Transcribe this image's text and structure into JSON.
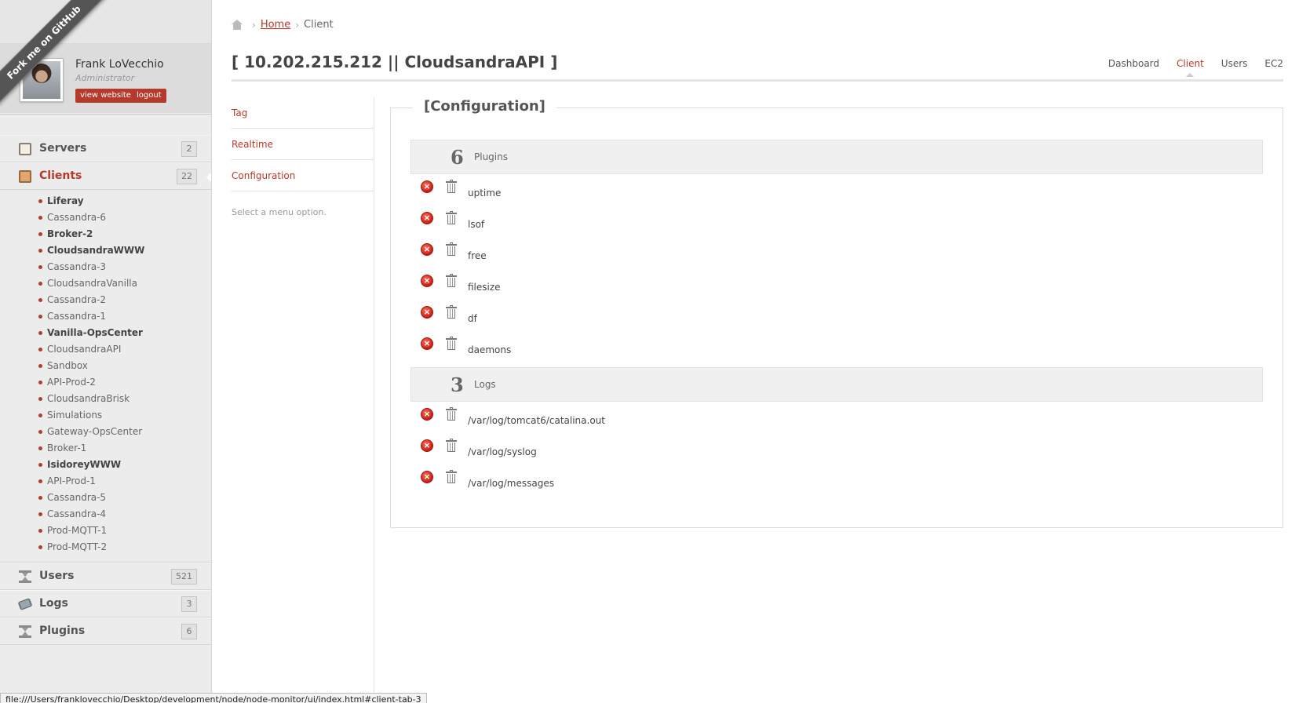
{
  "ribbon": {
    "label": "Fork me on GitHub"
  },
  "profile": {
    "name": "Frank LoVecchio",
    "role": "Administrator",
    "view_website_label": "view website",
    "logout_label": "logout"
  },
  "sidebar": {
    "servers": {
      "label": "Servers",
      "count": "2",
      "icon": "servers-icon"
    },
    "clients": {
      "label": "Clients",
      "count": "22",
      "icon": "clients-icon",
      "items": [
        {
          "label": "Liferay",
          "bold": true
        },
        {
          "label": "Cassandra-6",
          "bold": false
        },
        {
          "label": "Broker-2",
          "bold": true
        },
        {
          "label": "CloudsandraWWW",
          "bold": true
        },
        {
          "label": "Cassandra-3",
          "bold": false
        },
        {
          "label": "CloudsandraVanilla",
          "bold": false
        },
        {
          "label": "Cassandra-2",
          "bold": false
        },
        {
          "label": "Cassandra-1",
          "bold": false
        },
        {
          "label": "Vanilla-OpsCenter",
          "bold": true
        },
        {
          "label": "CloudsandraAPI",
          "bold": false
        },
        {
          "label": "Sandbox",
          "bold": false
        },
        {
          "label": "API-Prod-2",
          "bold": false
        },
        {
          "label": "CloudsandraBrisk",
          "bold": false
        },
        {
          "label": "Simulations",
          "bold": false
        },
        {
          "label": "Gateway-OpsCenter",
          "bold": false
        },
        {
          "label": "Broker-1",
          "bold": false
        },
        {
          "label": "IsidoreyWWW",
          "bold": true
        },
        {
          "label": "API-Prod-1",
          "bold": false
        },
        {
          "label": "Cassandra-5",
          "bold": false
        },
        {
          "label": "Cassandra-4",
          "bold": false
        },
        {
          "label": "Prod-MQTT-1",
          "bold": false
        },
        {
          "label": "Prod-MQTT-2",
          "bold": false
        }
      ]
    },
    "users": {
      "label": "Users",
      "count": "521",
      "icon": "users-icon"
    },
    "logs": {
      "label": "Logs",
      "count": "3",
      "icon": "logs-icon"
    },
    "plugins": {
      "label": "Plugins",
      "count": "6",
      "icon": "plugins-icon"
    }
  },
  "breadcrumb": {
    "home": "Home",
    "current": "Client"
  },
  "page": {
    "title": "[ 10.202.215.212 || CloudsandraAPI ]"
  },
  "topnav": {
    "items": [
      "Dashboard",
      "Client",
      "Users",
      "EC2"
    ],
    "active": "Client"
  },
  "submenu": {
    "items": [
      "Tag",
      "Realtime",
      "Configuration"
    ],
    "hint": "Select a menu option."
  },
  "config": {
    "legend": "[Configuration]",
    "plugins": {
      "count": "6",
      "label": "Plugins",
      "items": [
        "uptime",
        "lsof",
        "free",
        "filesize",
        "df",
        "daemons"
      ]
    },
    "logs": {
      "count": "3",
      "label": "Logs",
      "items": [
        "/var/log/tomcat6/catalina.out",
        "/var/log/syslog",
        "/var/log/messages"
      ]
    }
  },
  "statusbar": {
    "url": "file:///Users/franklovecchio/Desktop/development/node/node-monitor/ui/index.html#client-tab-3"
  },
  "colors": {
    "accent": "#b63a2c",
    "sidebar_bg": "#ececec",
    "group_bg": "#f0f0f0"
  }
}
